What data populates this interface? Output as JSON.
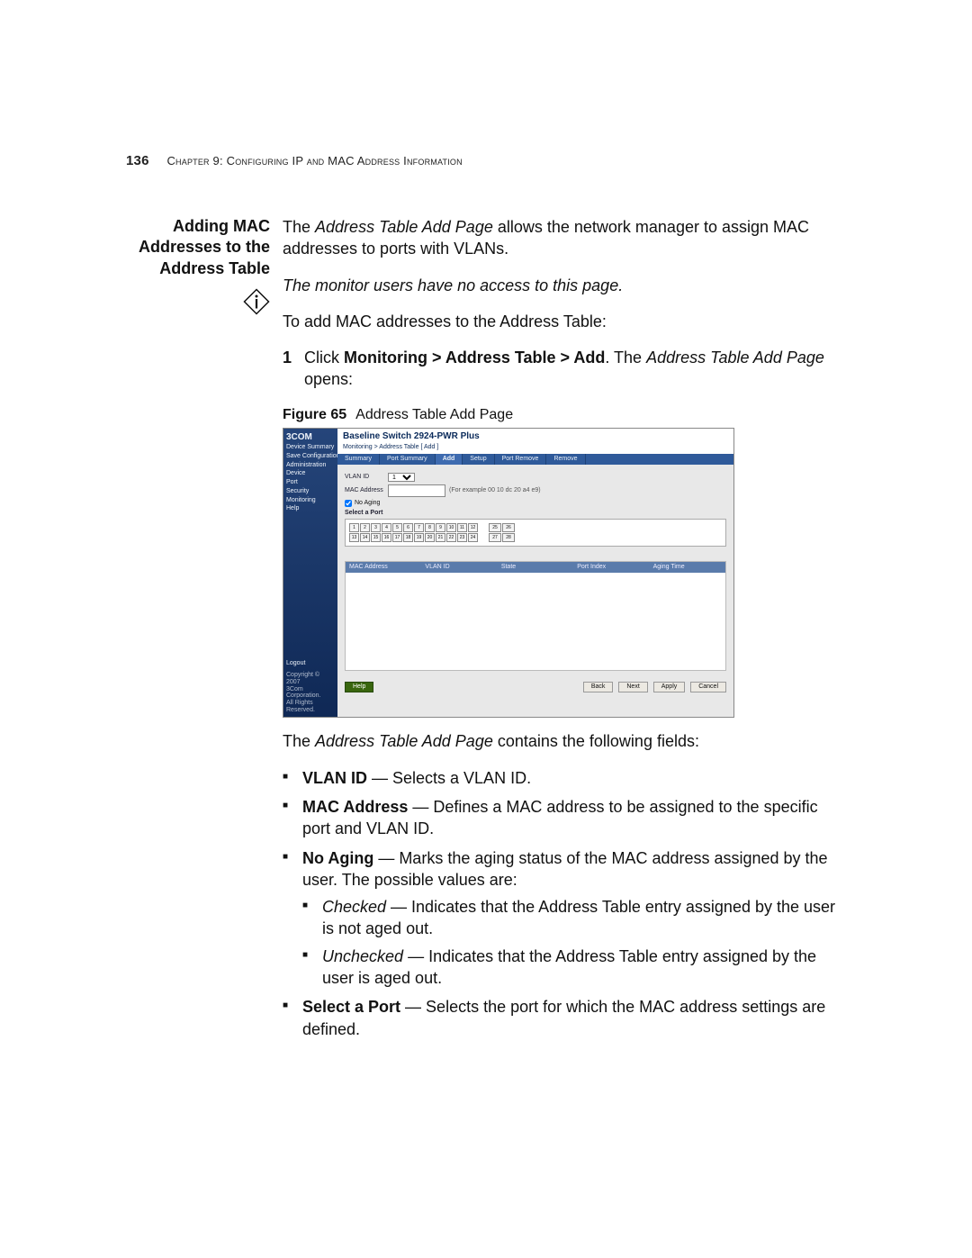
{
  "header": {
    "page_number": "136",
    "chapter_label": "Chapter 9: Configuring IP and MAC Address Information"
  },
  "margin": {
    "section_title_l1": "Adding MAC",
    "section_title_l2": "Addresses to the",
    "section_title_l3": "Address Table"
  },
  "body": {
    "intro_1a": "The ",
    "intro_1_em": "Address Table Add Page",
    "intro_1b": " allows the network manager to assign MAC addresses to ports with VLANs.",
    "note": "The monitor users have no access to this page.",
    "intro_2": "To add MAC addresses to the Address Table:",
    "step1_a": "Click ",
    "step1_bold": "Monitoring > Address Table > Add",
    "step1_b": ". The ",
    "step1_em": "Address Table Add Page",
    "step1_c": " opens:",
    "fig_label": "Figure 65",
    "fig_caption": "Address Table Add Page",
    "after_fig_a": "The ",
    "after_fig_em": "Address Table Add Page",
    "after_fig_b": " contains the following fields:",
    "bullets": {
      "vlan_bold": "VLAN ID",
      "vlan_txt": " — Selects a VLAN ID.",
      "mac_bold": "MAC Address",
      "mac_txt": " — Defines a MAC address to be assigned to the specific port and VLAN ID.",
      "aging_bold": "No Aging",
      "aging_txt": " — Marks the aging status of the MAC address assigned by the user. The possible values are:",
      "aging_sub1_em": "Checked",
      "aging_sub1_txt": " — Indicates that the Address Table entry assigned by the user is not aged out.",
      "aging_sub2_em": "Unchecked",
      "aging_sub2_txt": " — Indicates that the Address Table entry assigned by the user is aged out.",
      "port_bold": "Select a Port",
      "port_txt": " — Selects the port for which the MAC address settings are defined."
    }
  },
  "figure": {
    "brand": "3COM",
    "device_title": "Baseline Switch 2924-PWR Plus",
    "breadcrumb": "Monitoring > Address Table [ Add ]",
    "side_nav": [
      "Device Summary",
      "Save Configuration",
      "Administration",
      "Device",
      "Port",
      "Security",
      "Monitoring",
      "Help"
    ],
    "logout": "Logout",
    "copyright": "Copyright © 2007\n3Com Corporation.\nAll Rights Reserved.",
    "tabs": [
      "Summary",
      "Port Summary",
      "Add",
      "Setup",
      "Port Remove",
      "Remove"
    ],
    "active_tab_index": 2,
    "form": {
      "vlan_label": "VLAN ID",
      "vlan_value": "1",
      "mac_label": "MAC Address",
      "mac_hint": "(For example 00 10 dc 20 a4 e9)",
      "no_aging_label": "No Aging",
      "select_port_label": "Select a Port"
    },
    "ports_row1": [
      "1",
      "2",
      "3",
      "4",
      "5",
      "6",
      "7",
      "8",
      "9",
      "10",
      "11",
      "12"
    ],
    "ports_row2": [
      "13",
      "14",
      "15",
      "16",
      "17",
      "18",
      "19",
      "20",
      "21",
      "22",
      "23",
      "24"
    ],
    "ports_extra": [
      "25",
      "26",
      "27",
      "28"
    ],
    "table_headers": [
      "MAC Address",
      "VLAN ID",
      "State",
      "Port Index",
      "Aging Time"
    ],
    "buttons": {
      "help": "Help",
      "back": "Back",
      "next": "Next",
      "apply": "Apply",
      "cancel": "Cancel"
    }
  }
}
